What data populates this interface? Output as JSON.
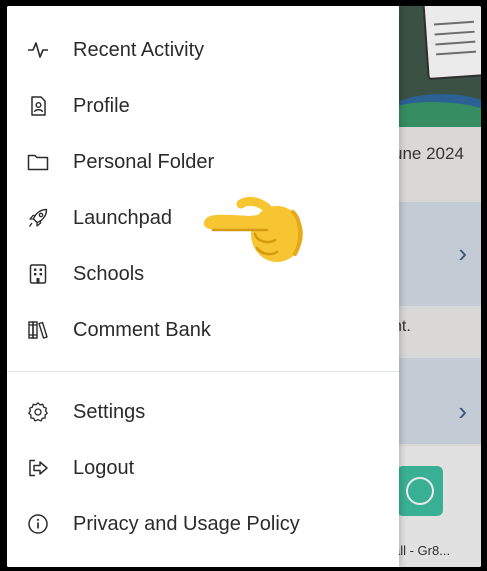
{
  "drawer": {
    "items": [
      {
        "label": "Recent Activity",
        "icon": "activity-icon"
      },
      {
        "label": "Profile",
        "icon": "profile-icon"
      },
      {
        "label": "Personal Folder",
        "icon": "folder-icon"
      },
      {
        "label": "Launchpad",
        "icon": "rocket-icon"
      },
      {
        "label": "Schools",
        "icon": "building-icon"
      },
      {
        "label": "Comment Bank",
        "icon": "books-icon"
      }
    ],
    "secondary_items": [
      {
        "label": "Settings",
        "icon": "gear-icon"
      },
      {
        "label": "Logout",
        "icon": "logout-icon"
      },
      {
        "label": "Privacy and Usage Policy",
        "icon": "info-icon"
      }
    ]
  },
  "background": {
    "date_text": "une 2024",
    "snippet_text": "nt.",
    "tile_label": "all - Gr8..."
  },
  "colors": {
    "header_bg": "#3f584a",
    "card_bg": "#d4dde6",
    "chevron": "#3a5f88",
    "tile_icon": "#3ebfa0"
  },
  "annotation": {
    "icon": "pointing-hand-emoji"
  }
}
